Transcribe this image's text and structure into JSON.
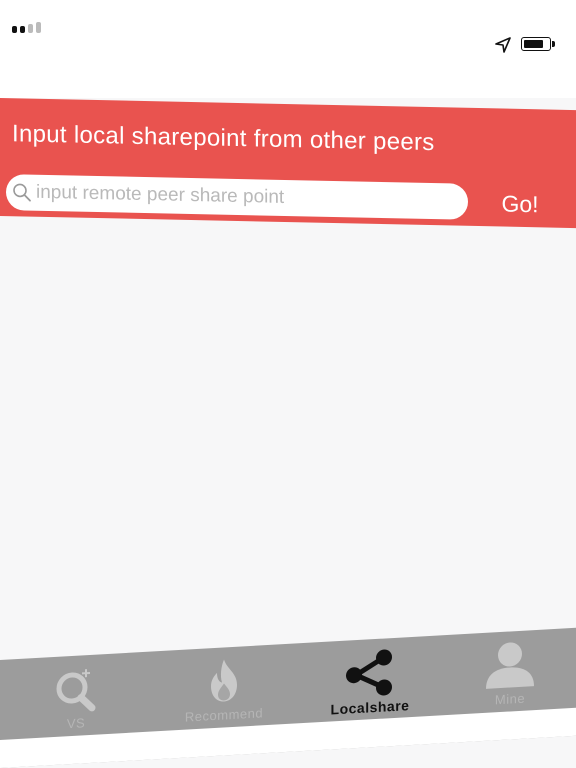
{
  "header": {
    "title": "Input local sharepoint from other peers",
    "search_placeholder": "input remote peer share point",
    "search_value": "",
    "go_label": "Go!",
    "accent_color": "#e9534f"
  },
  "tabbar": {
    "tabs": [
      {
        "label": "VS",
        "icon": "search-plus-icon",
        "active": false
      },
      {
        "label": "Recommend",
        "icon": "fire-icon",
        "active": false
      },
      {
        "label": "Localshare",
        "icon": "share-icon",
        "active": true
      },
      {
        "label": "Mine",
        "icon": "person-icon",
        "active": false
      }
    ]
  },
  "statusbar": {
    "icons": [
      "signal-icon",
      "location-arrow-icon",
      "battery-icon"
    ]
  }
}
